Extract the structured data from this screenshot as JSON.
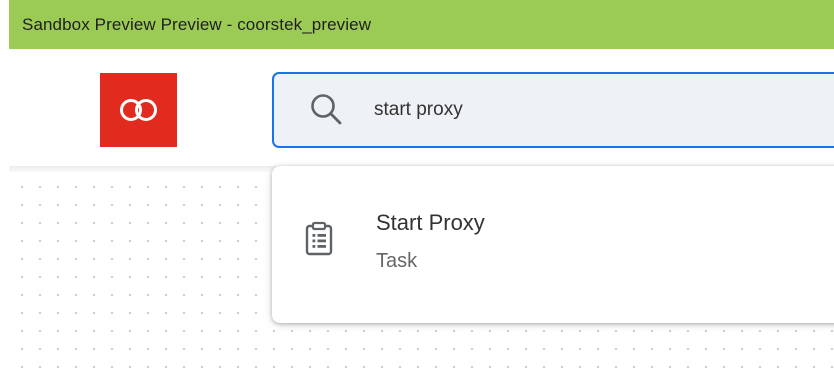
{
  "window": {
    "banner_title": "Sandbox Preview Preview - coorstek_preview",
    "banner_color": "#9ccb55"
  },
  "header": {
    "logo": {
      "icon": "infinity-icon",
      "color": "#e12b1f"
    }
  },
  "search": {
    "icon": "search-icon",
    "value": "start proxy",
    "accent_color": "#1a73e8"
  },
  "results": [
    {
      "icon": "clipboard-list-icon",
      "title": "Start Proxy",
      "type": "Task"
    }
  ]
}
